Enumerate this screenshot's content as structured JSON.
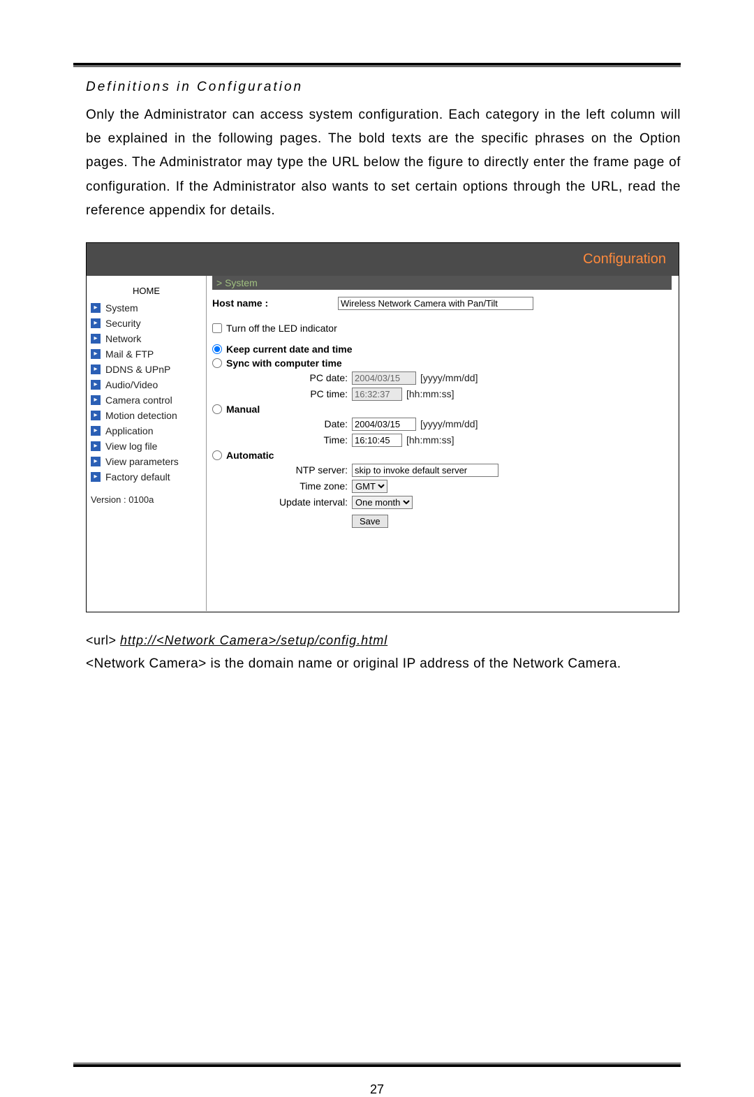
{
  "doc": {
    "section_title": "Definitions in Configuration",
    "body": "Only the Administrator can access system configuration. Each category in the left column will be explained in the following pages. The bold texts are the specific phrases on the Option pages. The Administrator may type the URL below the figure to directly enter the frame page of configuration. If the Administrator also wants to set certain options through the URL, read the reference appendix for details.",
    "url_prefix": "<url> ",
    "url_link": "http://<Network Camera>/setup/config.html",
    "note": "<Network Camera> is the domain name or original IP address of the Network Camera.",
    "page_number": "27"
  },
  "ss": {
    "header": "Configuration",
    "crumb": "> System",
    "home": "HOME",
    "nav": [
      "System",
      "Security",
      "Network",
      "Mail & FTP",
      "DDNS & UPnP",
      "Audio/Video",
      "Camera control",
      "Motion detection",
      "Application",
      "View log file",
      "View parameters",
      "Factory default"
    ],
    "version": "Version : 0100a",
    "hostname_label": "Host name :",
    "hostname_value": "Wireless Network Camera with Pan/Tilt",
    "led_label": "Turn off the LED indicator",
    "opt_keep": "Keep current date and time",
    "opt_sync": "Sync with computer time",
    "pc_date_label": "PC date:",
    "pc_date_value": "2004/03/15",
    "pc_date_hint": "[yyyy/mm/dd]",
    "pc_time_label": "PC time:",
    "pc_time_value": "16:32:37",
    "pc_time_hint": "[hh:mm:ss]",
    "opt_manual": "Manual",
    "manual_date_label": "Date:",
    "manual_date_value": "2004/03/15",
    "manual_date_hint": "[yyyy/mm/dd]",
    "manual_time_label": "Time:",
    "manual_time_value": "16:10:45",
    "manual_time_hint": "[hh:mm:ss]",
    "opt_auto": "Automatic",
    "ntp_label": "NTP server:",
    "ntp_value": "skip to invoke default server",
    "tz_label": "Time zone:",
    "tz_value": "GMT",
    "interval_label": "Update interval:",
    "interval_value": "One month",
    "save": "Save"
  }
}
